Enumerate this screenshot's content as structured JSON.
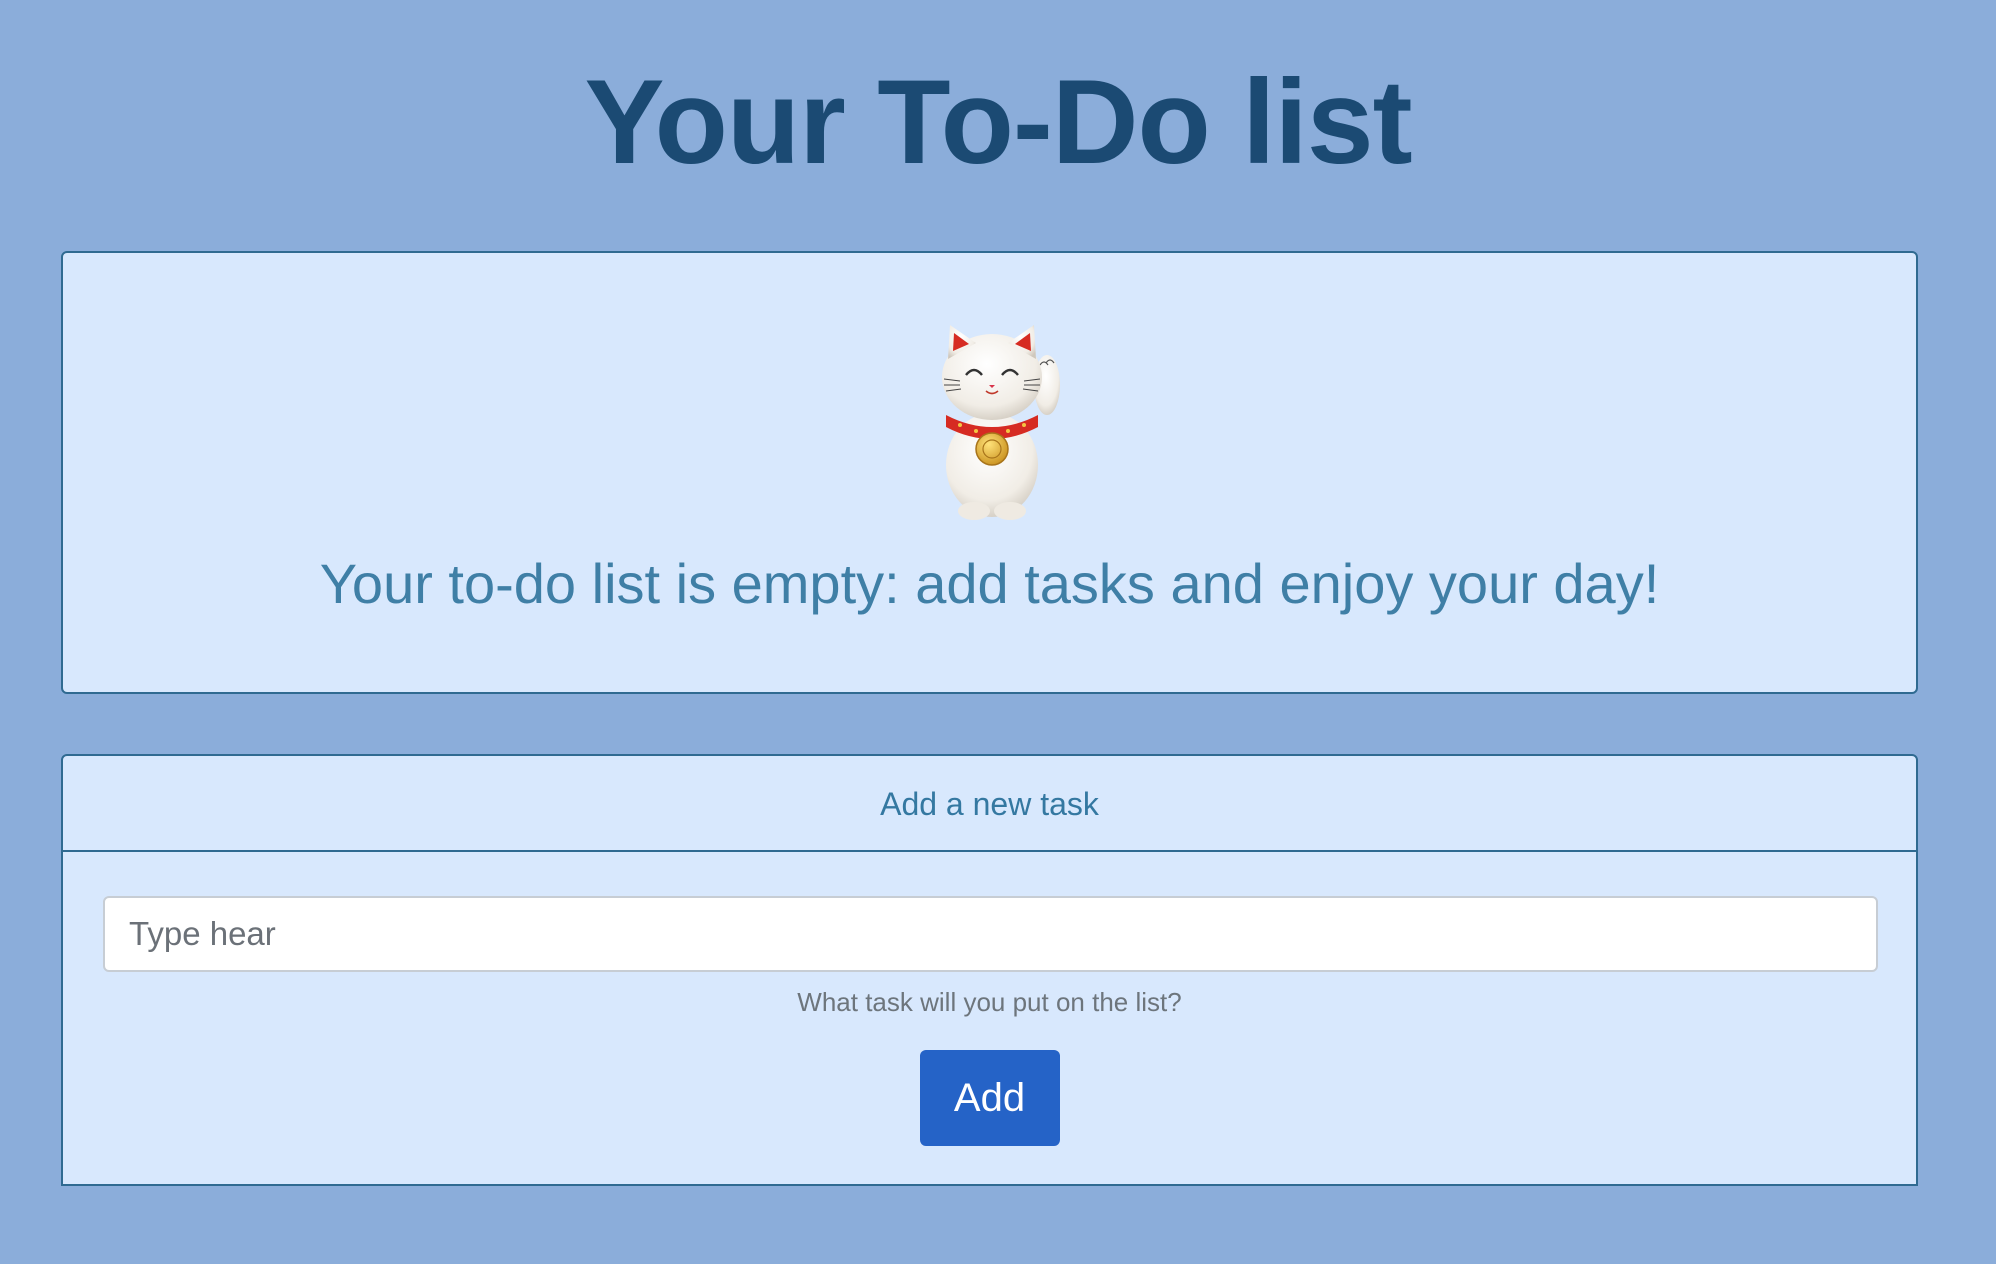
{
  "page": {
    "title": "Your To-Do list"
  },
  "empty_state": {
    "icon": "maneki-neko-cat-icon",
    "message": "Your to-do list is empty: add tasks and enjoy your day!"
  },
  "add_task": {
    "header": "Add a new task",
    "input_placeholder": "Type hear",
    "input_value": "",
    "helper_text": "What task will you put on the list?",
    "button_label": "Add"
  },
  "colors": {
    "background": "#8badda",
    "card_background": "#d8e8fd",
    "card_border": "#2f6a91",
    "title": "#1b4a73",
    "accent_text": "#3f7fa6",
    "button": "#2563c7"
  }
}
